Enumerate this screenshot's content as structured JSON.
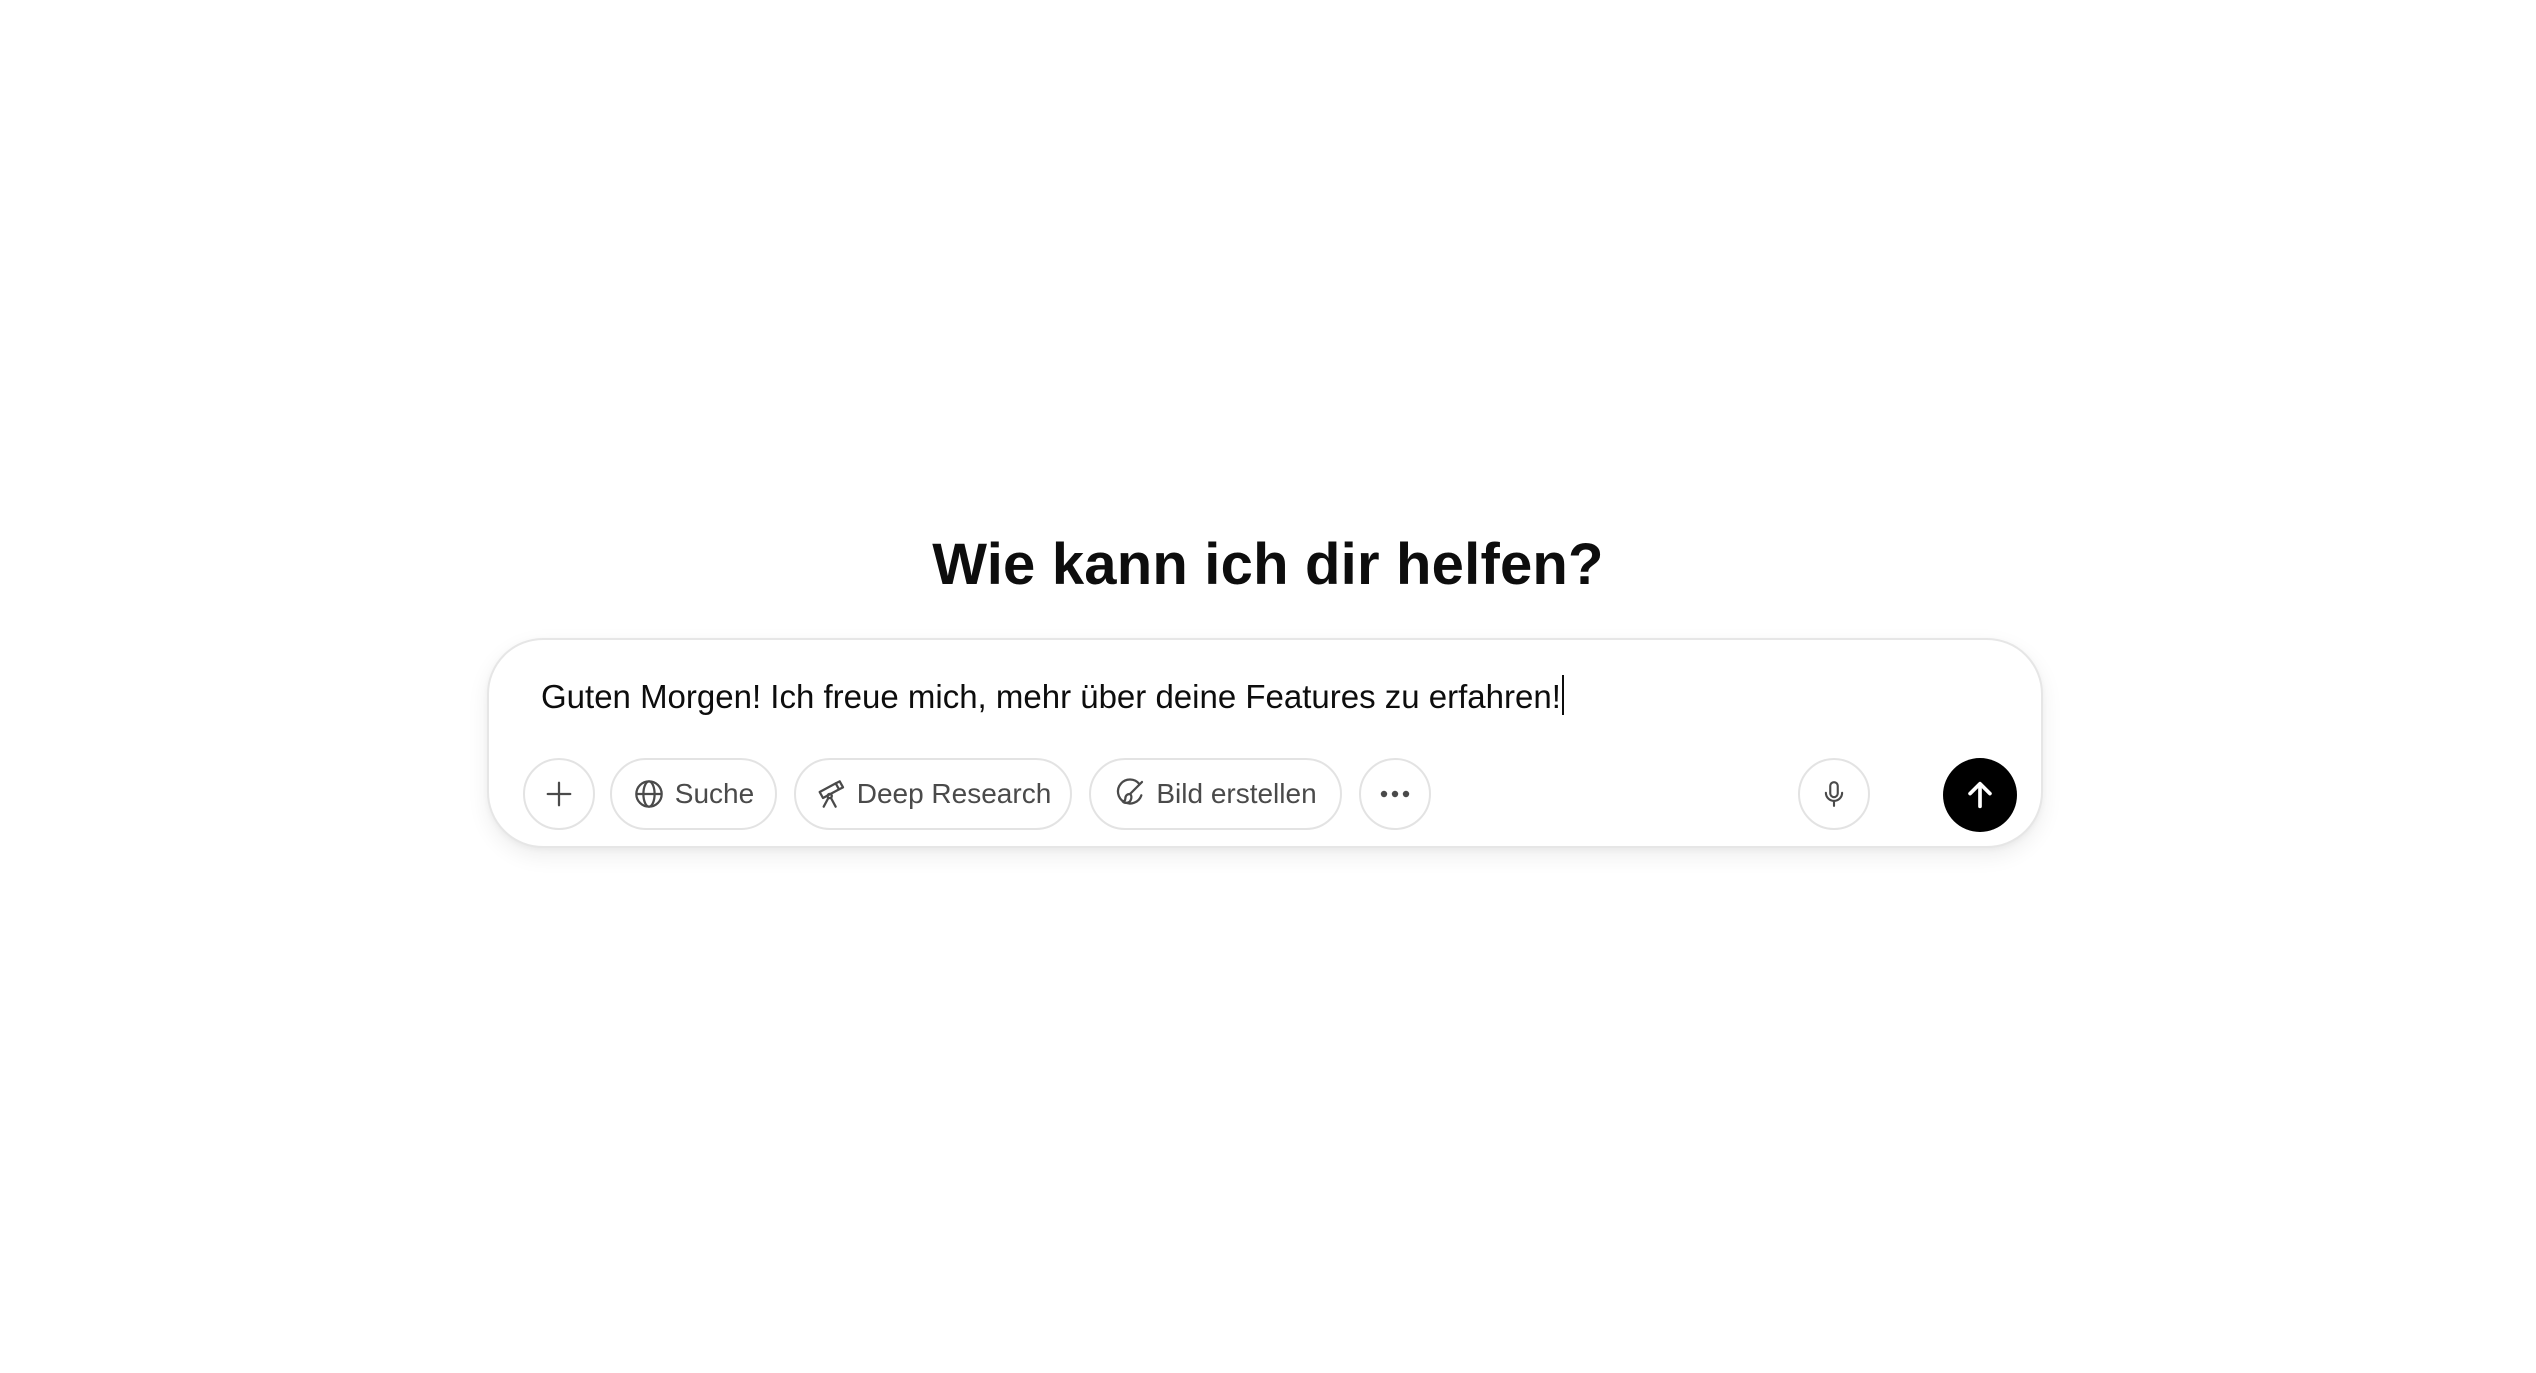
{
  "heading": "Wie kann ich dir helfen?",
  "composer": {
    "input_value": "Guten Morgen! Ich freue mich, mehr über deine Features zu erfahren!",
    "tools": {
      "add_icon": "plus-icon",
      "search_label": "Suche",
      "search_icon": "globe-icon",
      "deep_research_label": "Deep Research",
      "deep_research_icon": "telescope-icon",
      "image_label": "Bild erstellen",
      "image_icon": "brush-icon",
      "more_icon": "ellipsis-icon"
    },
    "mic_icon": "microphone-icon",
    "send_icon": "arrow-up-icon"
  },
  "colors": {
    "send_button": "#000000",
    "pill_border": "#e3e3e3",
    "text": "#0d0d0d"
  }
}
